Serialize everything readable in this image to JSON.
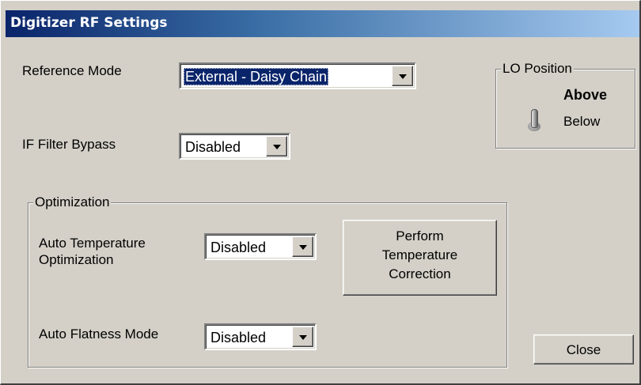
{
  "window": {
    "title": "Digitizer RF Settings"
  },
  "reference_mode": {
    "label": "Reference Mode",
    "value": "External - Daisy Chain"
  },
  "if_filter_bypass": {
    "label": "IF Filter Bypass",
    "value": "Disabled"
  },
  "lo_position": {
    "legend": "LO Position",
    "options": [
      "Above",
      "Below"
    ],
    "selected": "Above"
  },
  "optimization": {
    "legend": "Optimization",
    "auto_temperature": {
      "label_line1": "Auto Temperature",
      "label_line2": "Optimization",
      "value": "Disabled"
    },
    "perform_button": {
      "line1": "Perform",
      "line2": "Temperature",
      "line3": "Correction"
    },
    "auto_flatness": {
      "label": "Auto Flatness Mode",
      "value": "Disabled"
    }
  },
  "close_button": {
    "label": "Close"
  },
  "icons": {
    "dropdown": "chevron-down-icon",
    "toggle": "toggle-switch-icon"
  },
  "colors": {
    "title_start": "#0a246a",
    "title_end": "#a6caf0",
    "face": "#d4d0c8"
  }
}
